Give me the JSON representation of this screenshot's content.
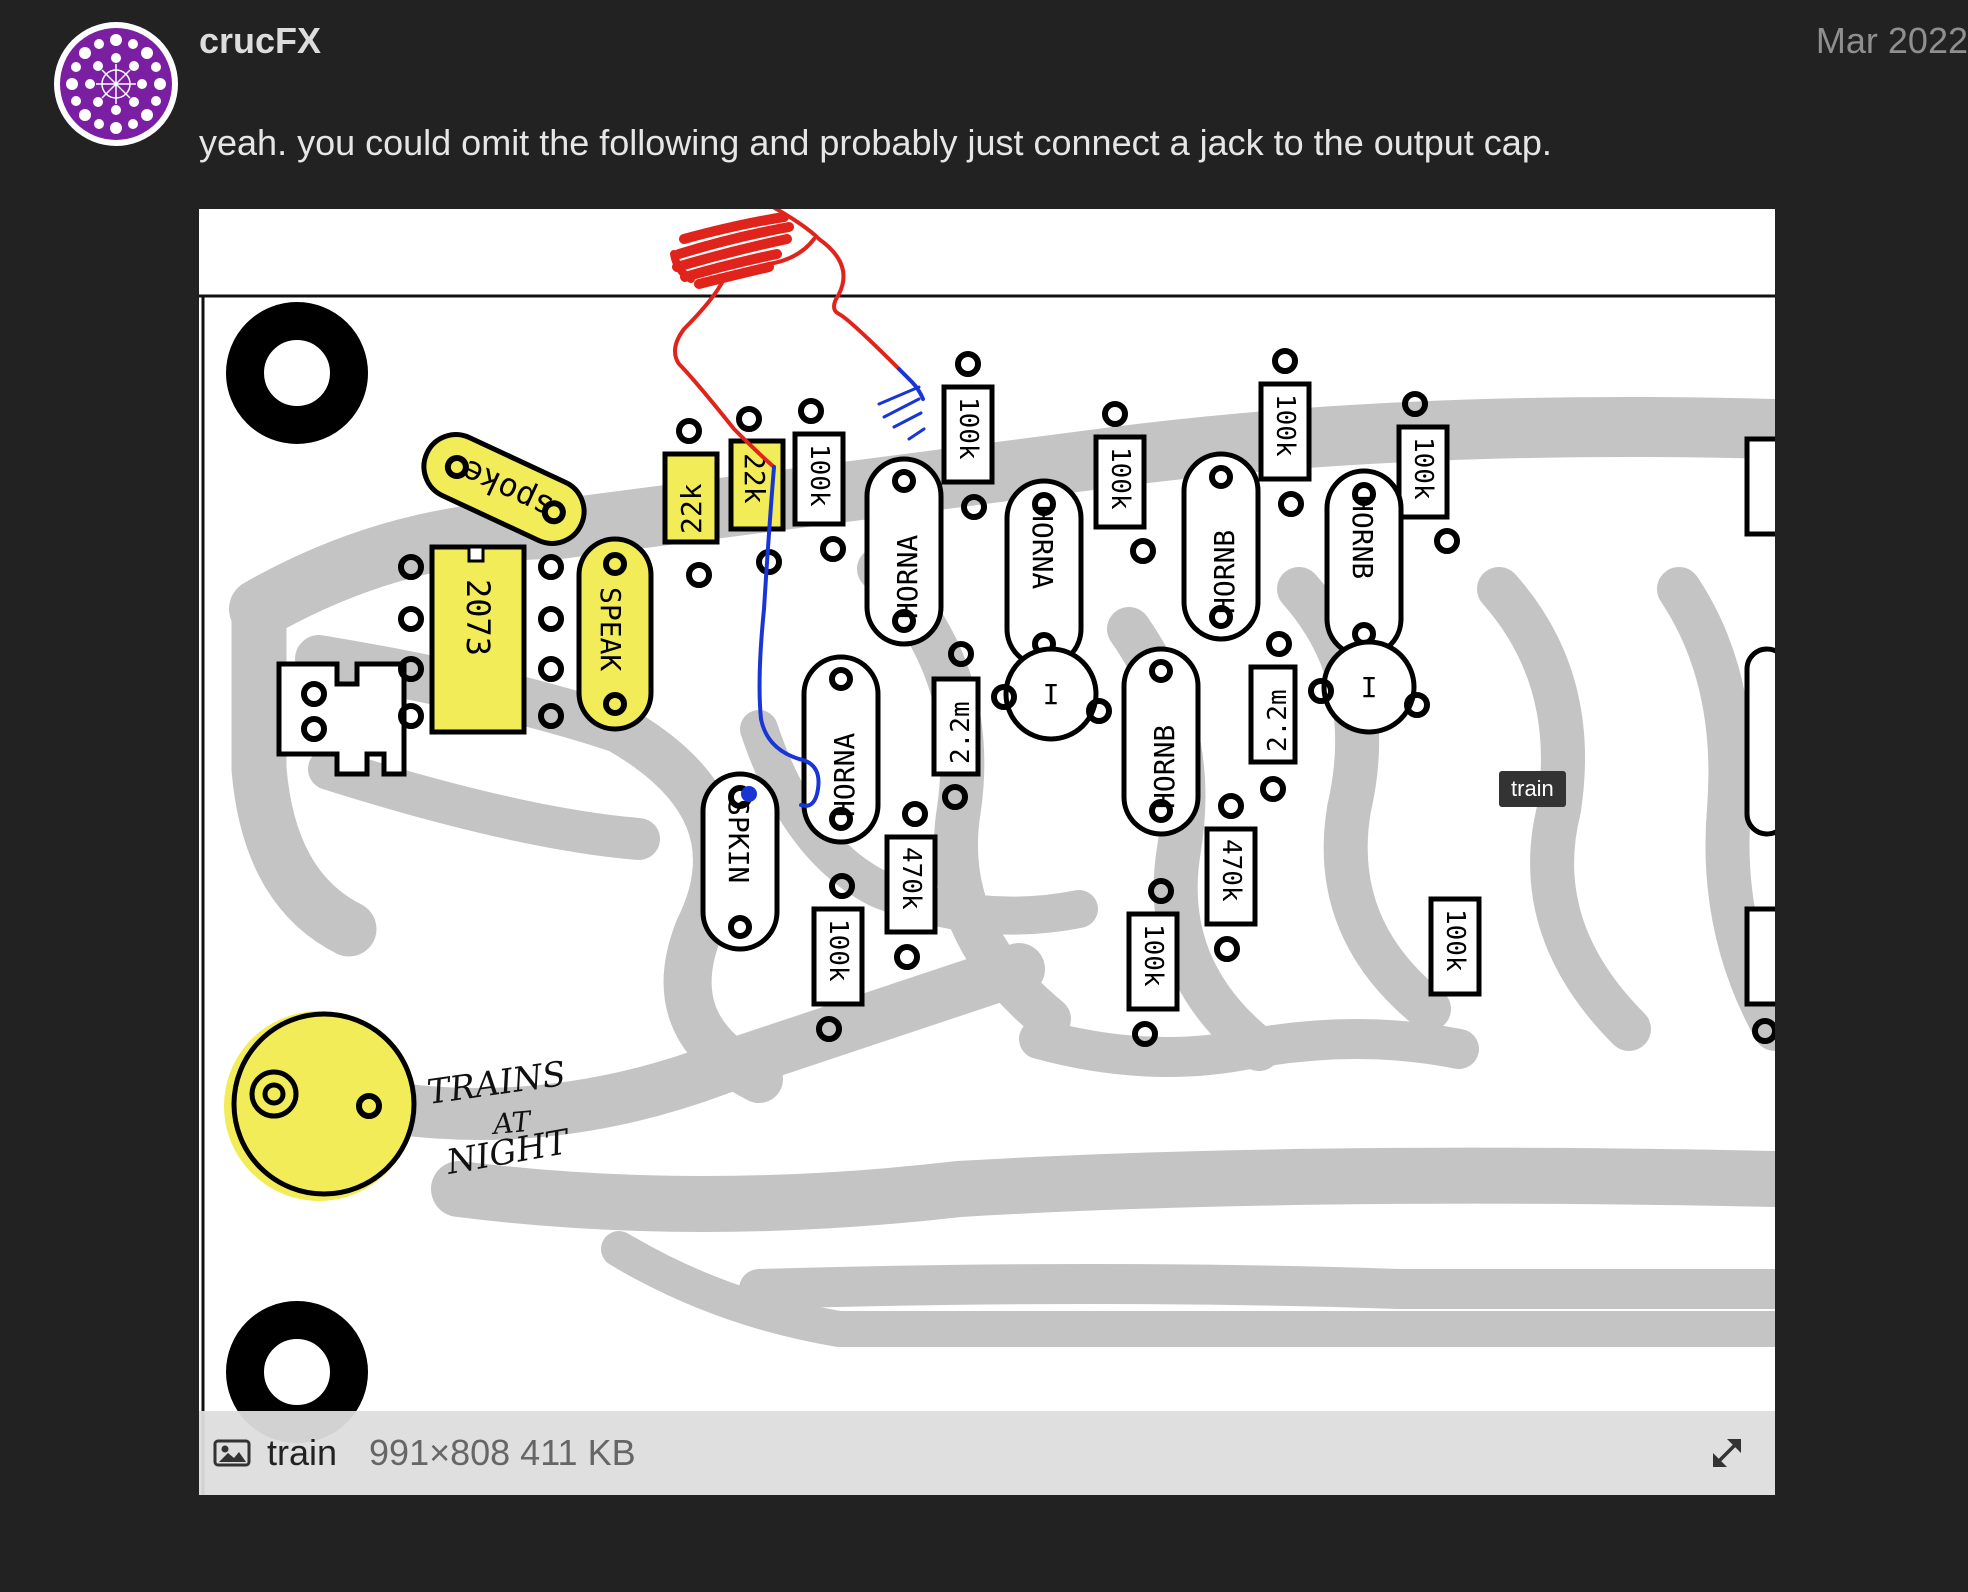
{
  "post": {
    "username": "crucFX",
    "date": "Mar 2022",
    "body": "yeah. you could omit the following and probably just connect a jack to the output cap.",
    "avatar_icon": "mandala-avatar-icon",
    "accent_color": "#7b1fa2"
  },
  "image": {
    "tooltip": "train",
    "filename": "train",
    "info": "991×808 411 KB",
    "image_icon": "image-icon",
    "expand_icon": "expand-icon",
    "labels": {
      "spoke": "spoke",
      "chip": "2073",
      "speak": "SPEAK",
      "r22k": "22k",
      "r100k": "100k",
      "r470k": "470k",
      "r22m": "2.2m",
      "horna": "HORNA",
      "hornb": "HORNB",
      "spkin": "SPKIN",
      "pot": "I",
      "scribble_1": "TRAINS",
      "scribble_2": "AT",
      "scribble_3": "NIGHT"
    }
  }
}
